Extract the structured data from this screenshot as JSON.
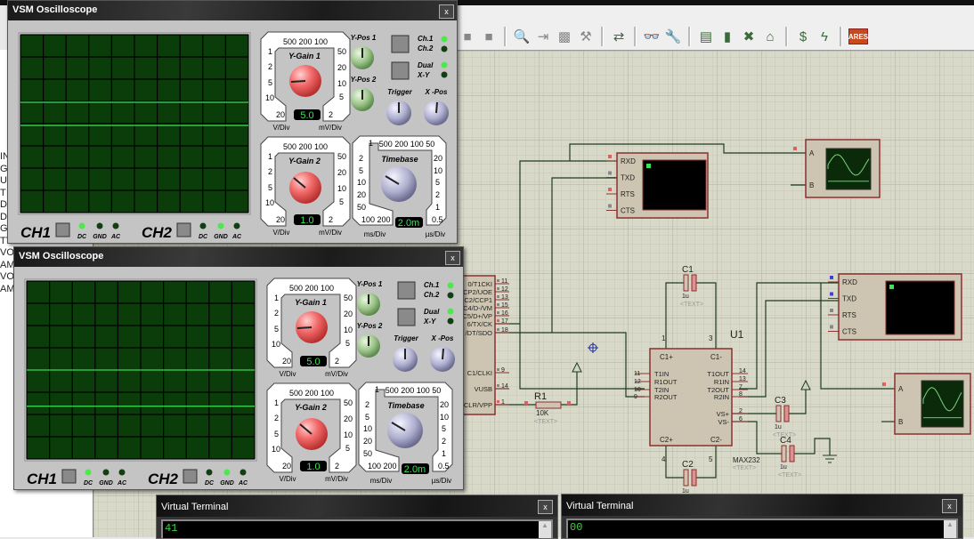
{
  "toolbar": {
    "icons": [
      "stop-square",
      "stop-square",
      "zoom-icon",
      "probe-icon",
      "chip-icon",
      "hammer-icon",
      "wire-autoroute-icon",
      "binoculars-search-icon",
      "property-tool-icon",
      "netlist-icon",
      "page-icon",
      "delete-icon",
      "decompose-icon",
      "bill-of-materials-icon",
      "electrical-rule-check-icon",
      "ares-icon"
    ],
    "ares_label": "ARES"
  },
  "sidebar_fragments": [
    "IN",
    "G",
    "U",
    "T",
    "D",
    "D",
    "GN",
    "TT",
    "VO",
    "AM",
    "VO",
    "AM"
  ],
  "colors": {
    "screen": "#0a3d0a",
    "trace": "#3ee05a",
    "wire": "#1d3b22",
    "component": "#8a3030",
    "led_on": "#4ee84e",
    "led_off": "#123f12"
  },
  "scopes": [
    {
      "title": "VSM Oscilloscope",
      "close": "x",
      "trace_offsets_div": [
        0.96,
        -0.08
      ],
      "ygain1": {
        "label": "Y-Gain 1",
        "top": "500 200 100",
        "left": [
          "1",
          "2",
          "5",
          "10"
        ],
        "bottom_left": "20",
        "right": [
          "50",
          "20",
          "10",
          "5"
        ],
        "bottom_right": "2",
        "value": "5.0",
        "unit_left": "V/Div",
        "unit_right": "mV/Div"
      },
      "ygain2": {
        "label": "Y-Gain 2",
        "top": "500 200 100",
        "left": [
          "1",
          "2",
          "5",
          "10"
        ],
        "bottom_left": "20",
        "right": [
          "50",
          "20",
          "10",
          "5"
        ],
        "bottom_right": "2",
        "value": "1.0",
        "unit_left": "V/Div",
        "unit_right": "mV/Div"
      },
      "timebase": {
        "label": "Timebase",
        "top_left": "1",
        "top": "500 200 100 50",
        "left": [
          "2",
          "5",
          "10",
          "20",
          "50"
        ],
        "bottom_left": "100 200",
        "right": [
          "20",
          "10",
          "5",
          "2",
          "1"
        ],
        "bottom_right": "0.5",
        "value": "2.0m",
        "unit_left": "ms/Div",
        "unit_right": "µs/Div"
      },
      "ypos1": "Y-Pos 1",
      "ypos2": "Y-Pos 2",
      "trigger": "Trigger",
      "xpos": "X -Pos",
      "ch1_label": "Ch.1",
      "ch2_label": "Ch.2",
      "dual_label": "Dual",
      "xy_label": "X-Y",
      "leds": {
        "ch1": true,
        "ch2": false,
        "dual": true,
        "xy": false
      },
      "ch1": {
        "label": "CH1",
        "coupling": [
          "DC",
          "GND",
          "AC"
        ],
        "active": "DC"
      },
      "ch2": {
        "label": "CH2",
        "coupling": [
          "DC",
          "GND",
          "AC"
        ],
        "active": "GND"
      }
    },
    {
      "title": "VSM Oscilloscope",
      "close": "x",
      "trace_offsets_div": [
        0.0,
        -1.63
      ],
      "ygain1": {
        "label": "Y-Gain 1",
        "top": "500 200 100",
        "left": [
          "1",
          "2",
          "5",
          "10"
        ],
        "bottom_left": "20",
        "right": [
          "50",
          "20",
          "10",
          "5"
        ],
        "bottom_right": "2",
        "value": "5.0",
        "unit_left": "V/Div",
        "unit_right": "mV/Div"
      },
      "ygain2": {
        "label": "Y-Gain 2",
        "top": "500 200 100",
        "left": [
          "1",
          "2",
          "5",
          "10"
        ],
        "bottom_left": "20",
        "right": [
          "50",
          "20",
          "10",
          "5"
        ],
        "bottom_right": "2",
        "value": "1.0",
        "unit_left": "V/Div",
        "unit_right": "mV/Div"
      },
      "timebase": {
        "label": "Timebase",
        "top_left": "1",
        "top": "500 200 100 50",
        "left": [
          "2",
          "5",
          "10",
          "20",
          "50"
        ],
        "bottom_left": "100 200",
        "right": [
          "20",
          "10",
          "5",
          "2",
          "1"
        ],
        "bottom_right": "0.5",
        "value": "2.0m",
        "unit_left": "ms/Div",
        "unit_right": "µs/Div"
      },
      "ypos1": "Y-Pos 1",
      "ypos2": "Y-Pos 2",
      "trigger": "Trigger",
      "xpos": "X -Pos",
      "ch1_label": "Ch.1",
      "ch2_label": "Ch.2",
      "dual_label": "Dual",
      "xy_label": "X-Y",
      "leds": {
        "ch1": true,
        "ch2": false,
        "dual": true,
        "xy": false
      },
      "ch1": {
        "label": "CH1",
        "coupling": [
          "DC",
          "GND",
          "AC"
        ],
        "active": "DC"
      },
      "ch2": {
        "label": "CH2",
        "coupling": [
          "DC",
          "GND",
          "AC"
        ],
        "active": "GND"
      }
    }
  ],
  "terminals": [
    {
      "title": "Virtual Terminal",
      "close": "x",
      "text": "41"
    },
    {
      "title": "Virtual Terminal",
      "close": "x",
      "text": "00"
    }
  ],
  "schematic": {
    "pic_pins": [
      {
        "name": "0/T1CKI",
        "num": "11"
      },
      {
        "name": "CP2/UOE",
        "num": "12"
      },
      {
        "name": "C2/CCP1",
        "num": "13"
      },
      {
        "name": "C4/D-/VM",
        "num": "15"
      },
      {
        "name": "C5/D+/VP",
        "num": "16"
      },
      {
        "name": "6/TX/CK",
        "num": "17"
      },
      {
        "name": "/DT/SDO",
        "num": "18"
      },
      {
        "name": "C1/CLKI",
        "num": "9"
      },
      {
        "name": "VUSB",
        "num": "14"
      },
      {
        "name": "CLR/VPP",
        "num": "1"
      }
    ],
    "u1": {
      "ref": "U1",
      "part": "MAX232",
      "text": "<TEXT>",
      "left_pins": [
        {
          "name": "T1IN",
          "num": "11"
        },
        {
          "name": "R1OUT",
          "num": "12"
        },
        {
          "name": "T2IN",
          "num": "10"
        },
        {
          "name": "R2OUT",
          "num": "9"
        }
      ],
      "right_pins": [
        {
          "name": "T1OUT",
          "num": "14"
        },
        {
          "name": "R1IN",
          "num": "13"
        },
        {
          "name": "T2OUT",
          "num": "7"
        },
        {
          "name": "R2IN",
          "num": "8"
        },
        {
          "name": "VS+",
          "num": "2"
        },
        {
          "name": "VS-",
          "num": "6"
        }
      ],
      "c_pins": {
        "c1p": "C1+",
        "c1m": "C1-",
        "c2p": "C2+",
        "c2m": "C2-",
        "n1": "1",
        "n3": "3",
        "n4": "4",
        "n5": "5"
      }
    },
    "r1": {
      "ref": "R1",
      "value": "10K",
      "text": "<TEXT>"
    },
    "c1": {
      "ref": "C1",
      "value": "1u",
      "text": "<TEXT>"
    },
    "c2": {
      "ref": "C2",
      "value": "1u"
    },
    "c3": {
      "ref": "C3",
      "value": "1u",
      "text": "<TEXT>"
    },
    "c4": {
      "ref": "C4",
      "value": "1u",
      "text": "<TEXT>"
    },
    "vterm_pins": [
      "RXD",
      "TXD",
      "RTS",
      "CTS"
    ],
    "scope_pins": [
      "A",
      "B"
    ]
  }
}
